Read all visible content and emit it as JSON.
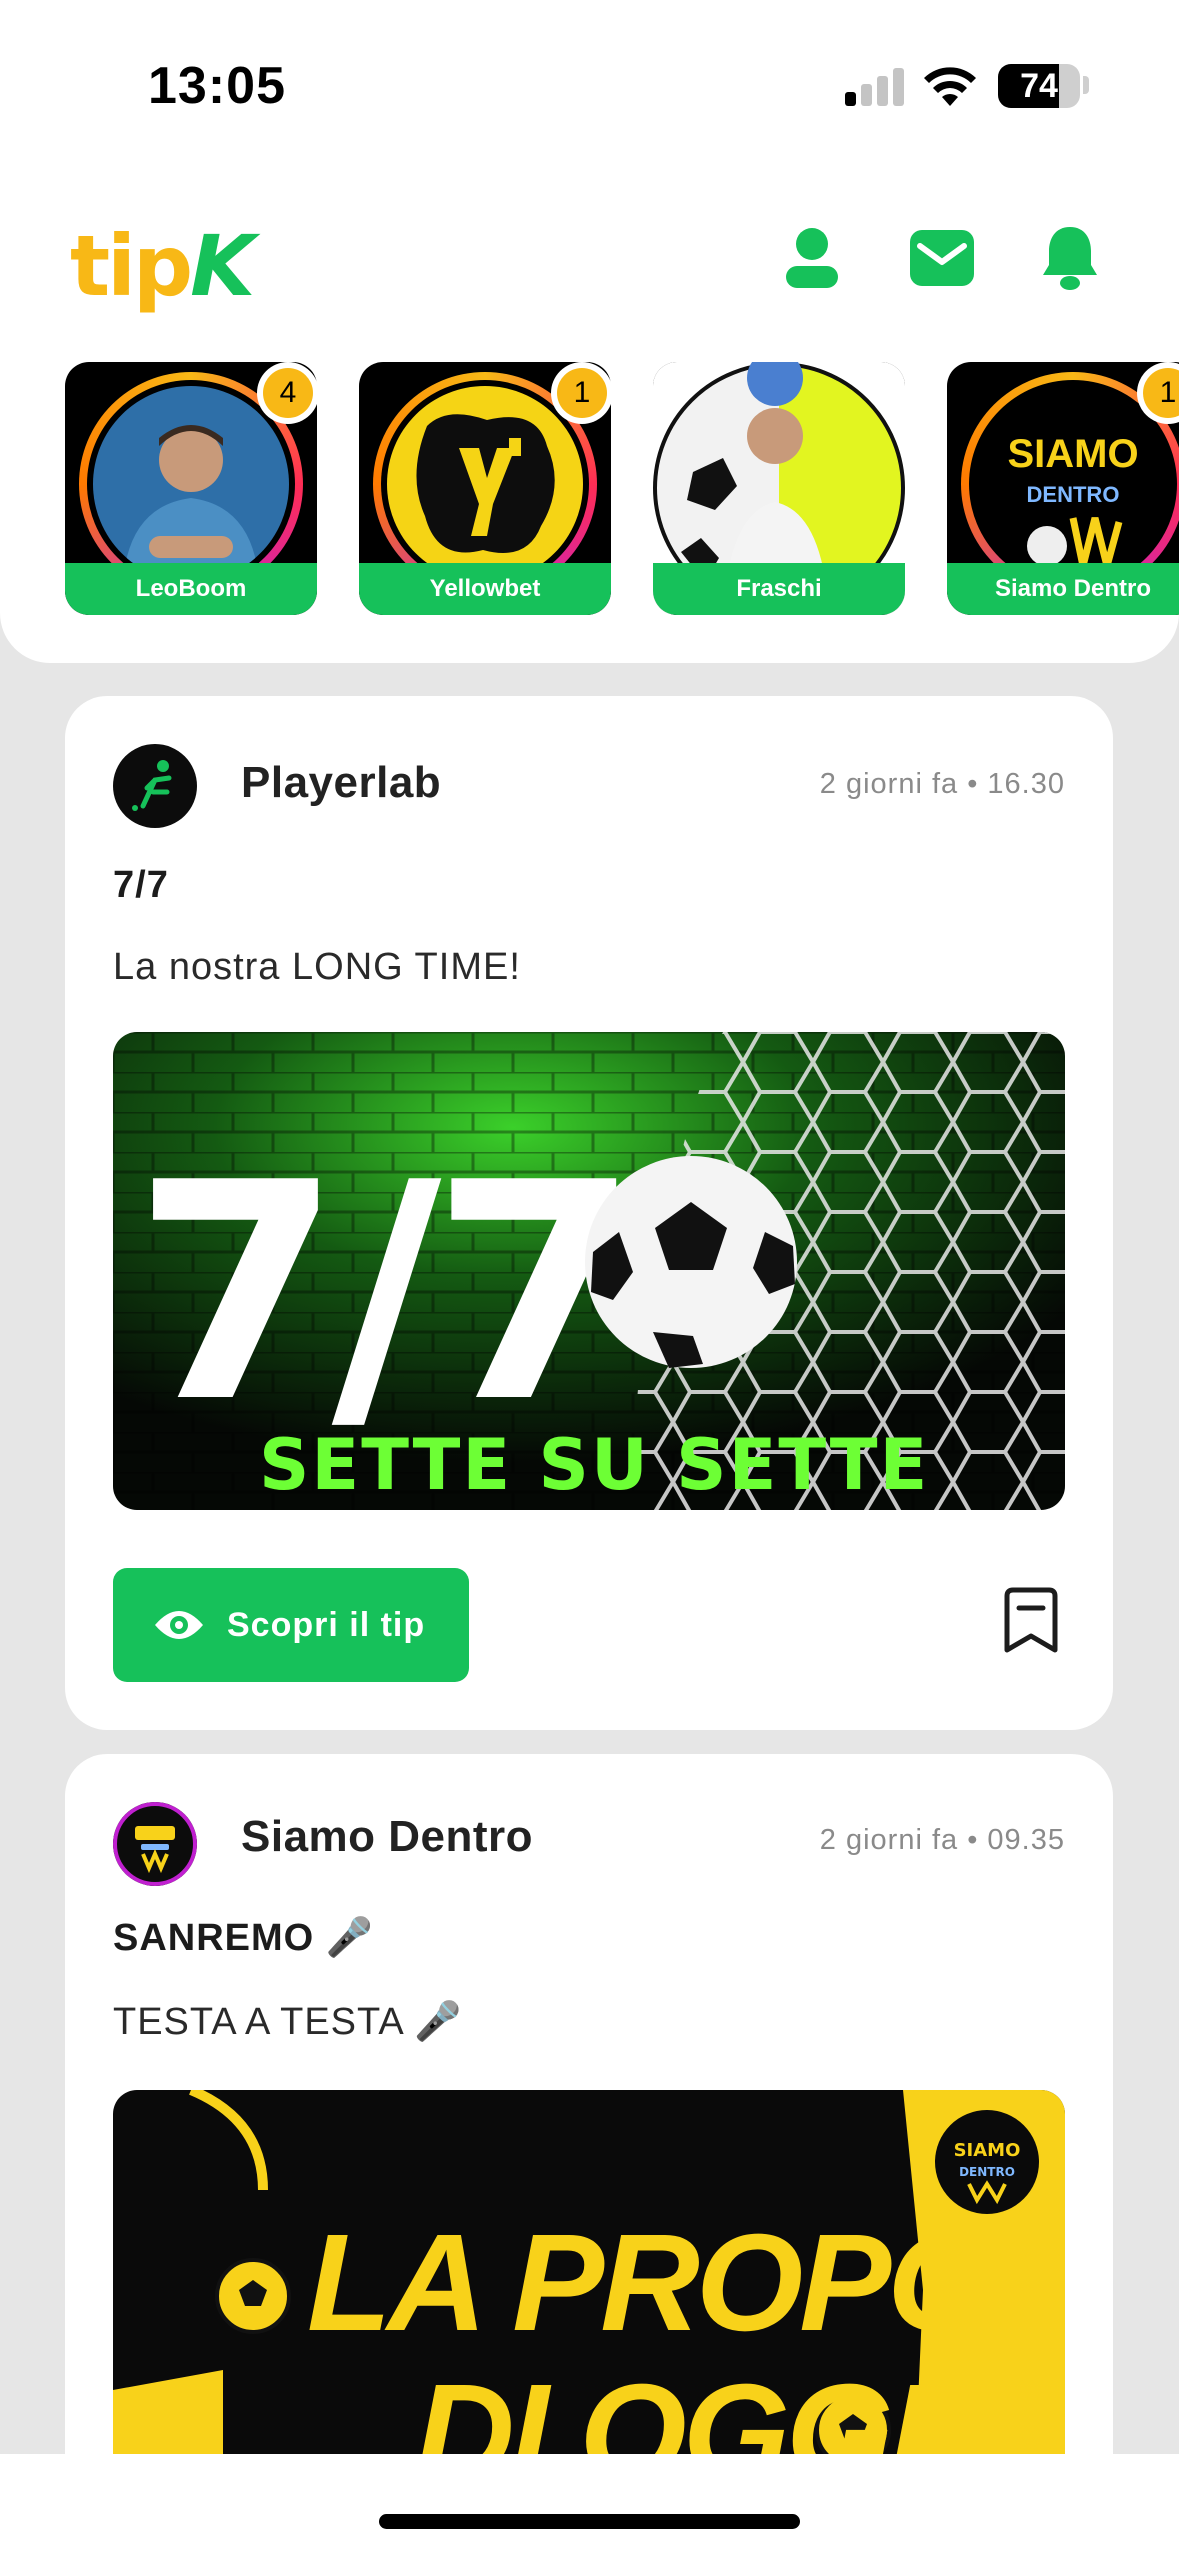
{
  "status_bar": {
    "time": "13:05",
    "battery_percent": 74
  },
  "brand": {
    "logo_text": "tipk"
  },
  "header_icons": [
    "profile-icon",
    "mail-icon",
    "bell-icon"
  ],
  "colors": {
    "brand_green": "#16c15a",
    "brand_yellow": "#f8b816",
    "page_background": "#e6e6e6"
  },
  "stories": [
    {
      "name": "LeoBoom",
      "badge": "4"
    },
    {
      "name": "Yellowbet",
      "badge": "1"
    },
    {
      "name": "Fraschi",
      "badge": ""
    },
    {
      "name": "Siamo Dentro",
      "badge": "1",
      "logo_text": [
        "SIAMO",
        "DENTRO"
      ]
    }
  ],
  "posts": [
    {
      "author": "Playerlab",
      "timestamp": "2 giorni fa • 16.30",
      "title": "7/7",
      "body": "La nostra LONG TIME!",
      "image_text": {
        "big": "7/7",
        "caption": "SETTE SU SETTE"
      },
      "cta_label": "Scopri il tip"
    },
    {
      "author": "Siamo Dentro",
      "timestamp": "2 giorni fa • 09.35",
      "title": "SANREMO 🎤",
      "body": "TESTA A TESTA 🎤",
      "image_text": {
        "line1": "LA PROPOSTA",
        "line2": "DI OGGI",
        "badge_line1": "SIAMO",
        "badge_line2": "DENTRO"
      }
    }
  ]
}
